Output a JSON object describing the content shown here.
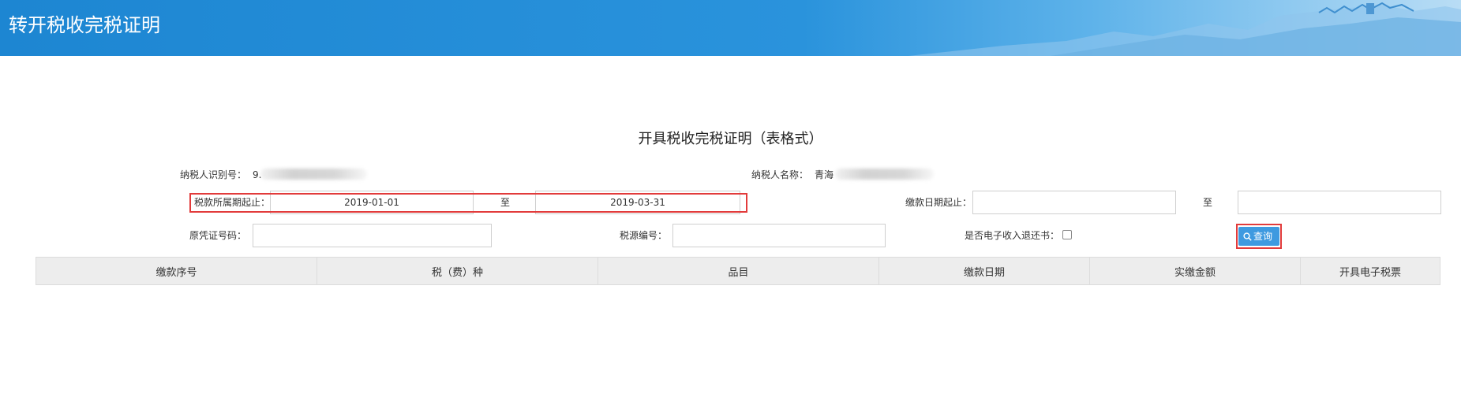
{
  "header": {
    "title": "转开税收完税证明"
  },
  "form": {
    "section_title": "开具税收完税证明（表格式）",
    "taxpayer_id_label": "纳税人识别号：",
    "taxpayer_id_value": "9.",
    "taxpayer_name_label": "纳税人名称：",
    "taxpayer_name_value": "青海",
    "tax_period_label": "税款所属期起止：",
    "tax_period_start": "2019-01-01",
    "tax_period_to": "至",
    "tax_period_end": "2019-03-31",
    "payment_date_label": "缴款日期起止：",
    "payment_date_start": "",
    "payment_date_to": "至",
    "payment_date_end": "",
    "original_voucher_label": "原凭证号码：",
    "original_voucher_value": "",
    "tax_source_label": "税源编号：",
    "tax_source_value": "",
    "e_refund_label": "是否电子收入退还书：",
    "e_refund_checked": false,
    "query_label": "查询"
  },
  "table": {
    "columns": [
      "缴款序号",
      "税（费）种",
      "品目",
      "缴款日期",
      "实缴金额",
      "开具电子税票"
    ]
  },
  "colors": {
    "header_blue": "#1d86d2",
    "highlight_red": "#e23b3b",
    "button_blue": "#3e9ae0"
  },
  "icons": {
    "query_icon": "search-icon"
  }
}
